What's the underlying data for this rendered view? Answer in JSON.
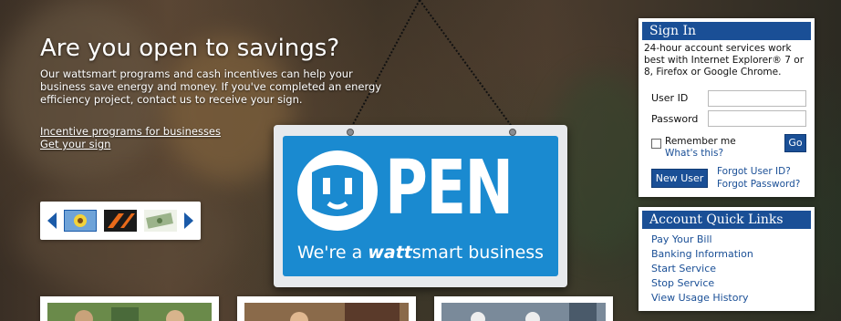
{
  "hero": {
    "title": "Are you open to savings?",
    "description": "Our wattsmart programs and cash incentives can help your business save energy and money. If you've completed an energy efficiency project, contact us to receive your sign.",
    "links": [
      "Incentive programs for businesses",
      "Get your sign"
    ]
  },
  "sign": {
    "word": "PEN",
    "tagline_pre": "We're a ",
    "tagline_brand": "watt",
    "tagline_post": "smart business",
    "colors": {
      "blue": "#1a8ad0",
      "frame": "#e7e9ec"
    }
  },
  "signin": {
    "title": "Sign In",
    "note": "24-hour account services work best with Internet Explorer® 7 or 8, Firefox or Google Chrome.",
    "user_id_label": "User ID",
    "user_id_value": "",
    "password_label": "Password",
    "password_value": "",
    "remember_label": "Remember me",
    "whats_this": "What's this?",
    "go_label": "Go",
    "new_user_label": "New User",
    "forgot_user": "Forgot User ID?",
    "forgot_password": "Forgot Password?"
  },
  "quick_links": {
    "title": "Account Quick Links",
    "items": [
      "Pay Your Bill",
      "Banking Information",
      "Start Service",
      "Stop Service",
      "View Usage History"
    ]
  },
  "carousel": {
    "thumbnails": [
      "sunflower-thumb",
      "orange-pattern-thumb",
      "money-thumb"
    ]
  },
  "colors": {
    "brand_blue": "#1a4f96",
    "link_blue": "#1a4f96"
  }
}
